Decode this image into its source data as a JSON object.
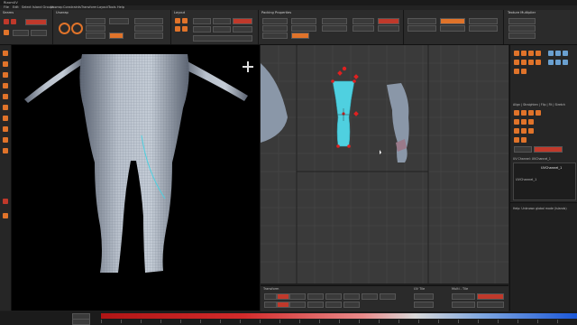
{
  "titlebar": {
    "title": "RizomUV"
  },
  "menu": [
    "File",
    "Edit",
    "Select",
    "Island Groups",
    "Unwrap",
    "Constraints",
    "Transform",
    "Layout",
    "Tools",
    "Help"
  ],
  "panels": {
    "seams": "Seams",
    "unwrap": "Unwrap",
    "layout": "Layout",
    "packing": "Packing Properties",
    "texture": "Texture Multiplier"
  },
  "right_panel": {
    "align_label": "Align | Straighten | Flip | Fit | Stretch",
    "uv_channel_label": "UV Channel: UVChannel_1",
    "uv_channel_value": "UVChannel_1",
    "uv_channel_item": "UVChannel_1",
    "help_text": "Help: Unknown global mode (Islands)"
  },
  "bottom": {
    "transform_label": "Transform",
    "uv_tile_label": "UV Tile",
    "multi_tile_label": "Multi - Tile"
  },
  "colors": {
    "uv_island_selected": "#4fd0e0",
    "uv_island_other": "#8a97a8",
    "handle": "#e02020",
    "viewport_bg": "#000000",
    "uv_bg": "#3a3a3a"
  }
}
